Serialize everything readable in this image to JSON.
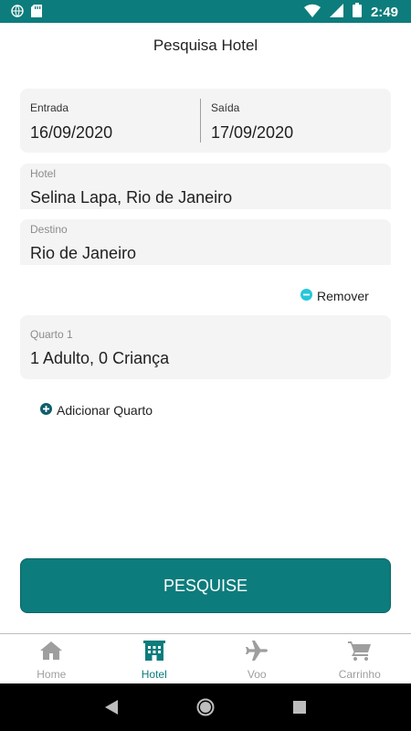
{
  "status_bar": {
    "time": "2:49"
  },
  "page": {
    "title": "Pesquisa Hotel"
  },
  "dates": {
    "checkin_label": "Entrada",
    "checkin_value": "16/09/2020",
    "checkout_label": "Saída",
    "checkout_value": "17/09/2020"
  },
  "hotel": {
    "label": "Hotel",
    "value": "Selina Lapa, Rio de Janeiro"
  },
  "destination": {
    "label": "Destino",
    "value": "Rio de Janeiro"
  },
  "remove": {
    "label": "Remover"
  },
  "room": {
    "label": "Quarto 1",
    "value": "1 Adulto, 0 Criança"
  },
  "add_room": {
    "label": "Adicionar Quarto"
  },
  "search_button": {
    "label": "PESQUISE"
  },
  "bottom_nav": {
    "items": [
      {
        "label": "Home",
        "icon": "home-icon",
        "active": false
      },
      {
        "label": "Hotel",
        "icon": "hotel-icon",
        "active": true
      },
      {
        "label": "Voo",
        "icon": "airplane-icon",
        "active": false
      },
      {
        "label": "Carrinho",
        "icon": "cart-icon",
        "active": false
      }
    ]
  },
  "colors": {
    "accent": "#0d7c7c",
    "remove_icon": "#26c6da",
    "add_icon": "#0d5e6b",
    "card_bg": "#f4f4f4",
    "inactive": "#9e9e9e"
  }
}
